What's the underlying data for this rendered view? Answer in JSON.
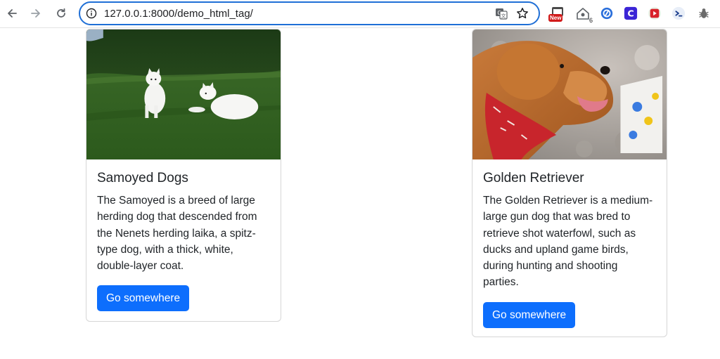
{
  "browser": {
    "url": "127.0.0.1:8000/demo_html_tag/",
    "extensions": [
      {
        "name": "new-badge-extension",
        "badge": "New"
      },
      {
        "name": "home-counter-extension",
        "count": "6"
      },
      {
        "name": "blue-circle-extension"
      },
      {
        "name": "c-extension",
        "letter": "C"
      },
      {
        "name": "red-play-extension"
      },
      {
        "name": "terminal-extension"
      },
      {
        "name": "bug-extension"
      }
    ]
  },
  "cards": [
    {
      "title": "Samoyed Dogs",
      "text": "The Samoyed is a breed of large herding dog that descended from the Nenets herding laika, a spitz-type dog, with a thick, white, double-layer coat.",
      "button": "Go somewhere"
    },
    {
      "title": "Golden Retriever",
      "text": "The Golden Retriever is a medium-large gun dog that was bred to retrieve shot waterfowl, such as ducks and upland game birds, during hunting and shooting parties.",
      "button": "Go somewhere"
    }
  ],
  "colors": {
    "primary_button": "#0d6efd",
    "omnibox_border": "#1f6fd6",
    "text": "#212529"
  }
}
